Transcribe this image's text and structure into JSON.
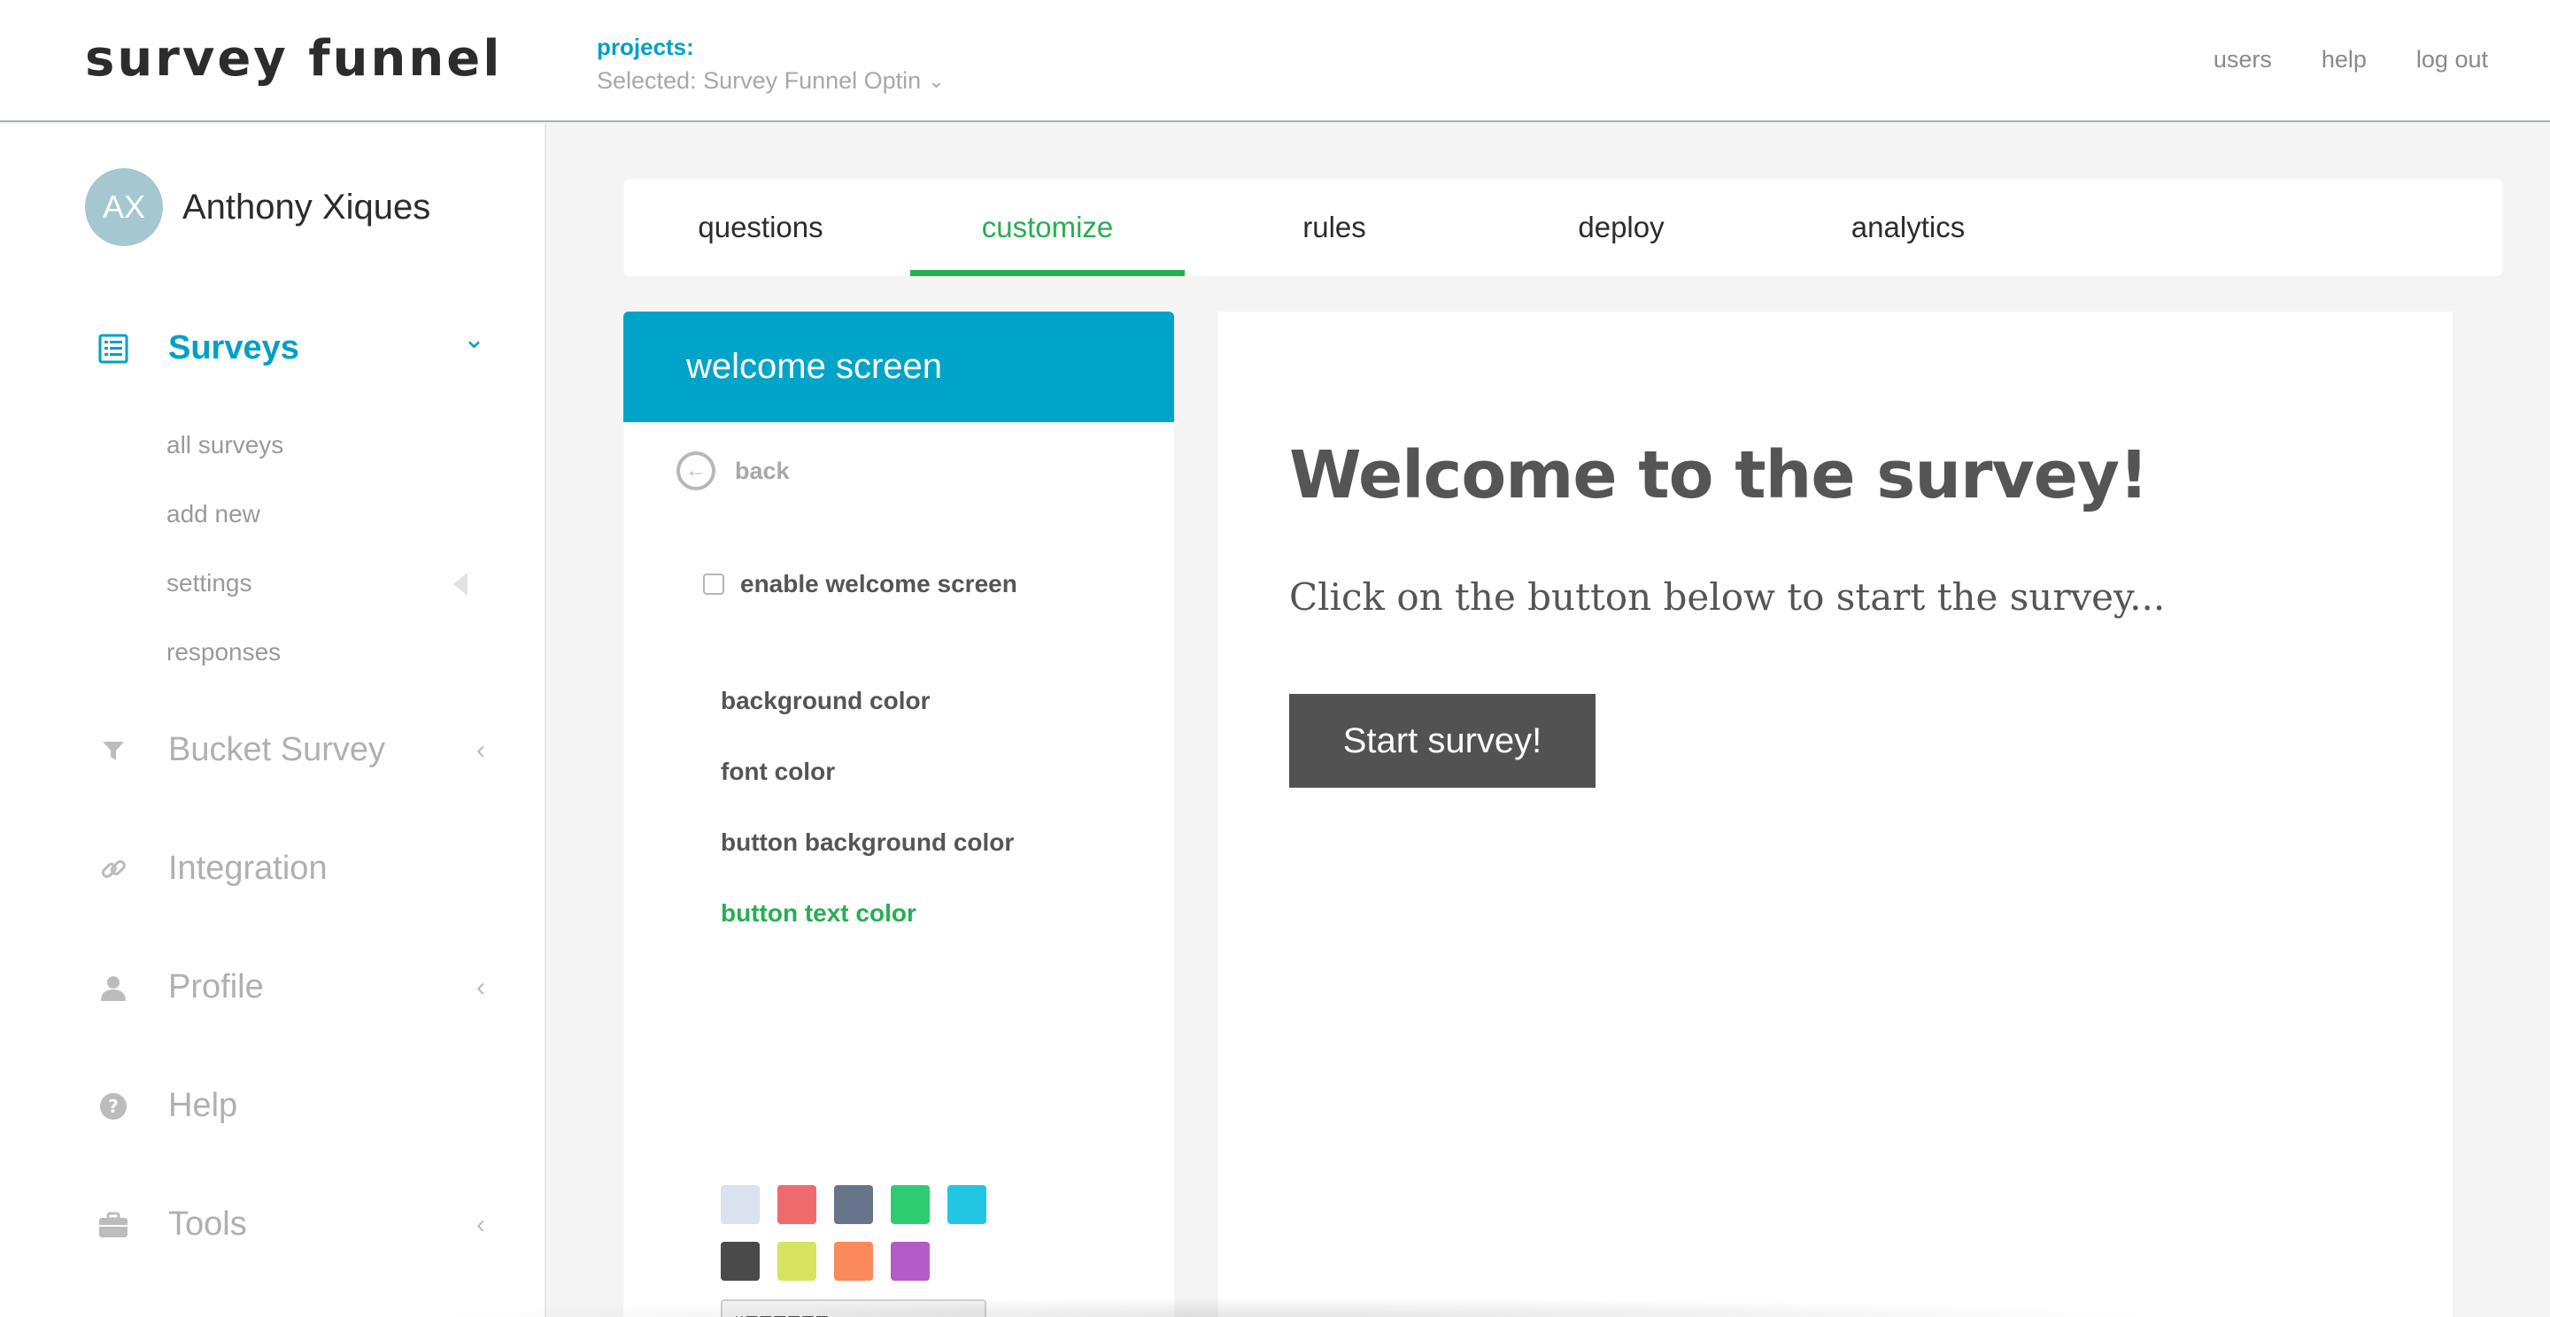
{
  "header": {
    "logo": "survey funnel",
    "projects_label": "projects:",
    "project_selected": "Selected: Survey Funnel Optin",
    "links": [
      {
        "label": "users"
      },
      {
        "label": "help"
      },
      {
        "label": "log out"
      }
    ]
  },
  "user": {
    "initials": "AX",
    "name": "Anthony Xiques"
  },
  "sidebar": {
    "surveys": {
      "label": "Surveys",
      "icon": "survey-list-icon",
      "expanded": true,
      "subitems": [
        {
          "label": "all surveys"
        },
        {
          "label": "add new"
        },
        {
          "label": "settings"
        },
        {
          "label": "responses"
        }
      ]
    },
    "items": [
      {
        "label": "Bucket Survey",
        "icon": "filter-icon",
        "has_chevron": true
      },
      {
        "label": "Integration",
        "icon": "link-icon",
        "has_chevron": false
      },
      {
        "label": "Profile",
        "icon": "user-icon",
        "has_chevron": true
      },
      {
        "label": "Help",
        "icon": "question-icon",
        "has_chevron": false
      },
      {
        "label": "Tools",
        "icon": "briefcase-icon",
        "has_chevron": true
      }
    ]
  },
  "tabs": [
    {
      "label": "questions"
    },
    {
      "label": "customize",
      "active": true
    },
    {
      "label": "rules"
    },
    {
      "label": "deploy"
    },
    {
      "label": "analytics"
    }
  ],
  "panel": {
    "title": "welcome screen",
    "back_label": "back",
    "enable_label": "enable welcome screen",
    "enable_checked": false,
    "options": [
      {
        "label": "background color"
      },
      {
        "label": "font color"
      },
      {
        "label": "button background color"
      },
      {
        "label": "button text color",
        "active": true
      }
    ],
    "swatches": [
      "#d9e2ee",
      "#ef6a6a",
      "#67758a",
      "#2dcc70",
      "#20c6e3",
      "#4a4a4a",
      "#d5e35f",
      "#fa8a5b",
      "#b35cc7"
    ],
    "hex_value": "#FFFFFF"
  },
  "preview": {
    "title": "Welcome to the survey!",
    "subtitle": "Click on the button below to start the survey...",
    "button_label": "Start survey!"
  },
  "colors": {
    "accent_blue": "#00a4c9",
    "accent_green": "#27ae52",
    "button_dark": "#525252"
  }
}
